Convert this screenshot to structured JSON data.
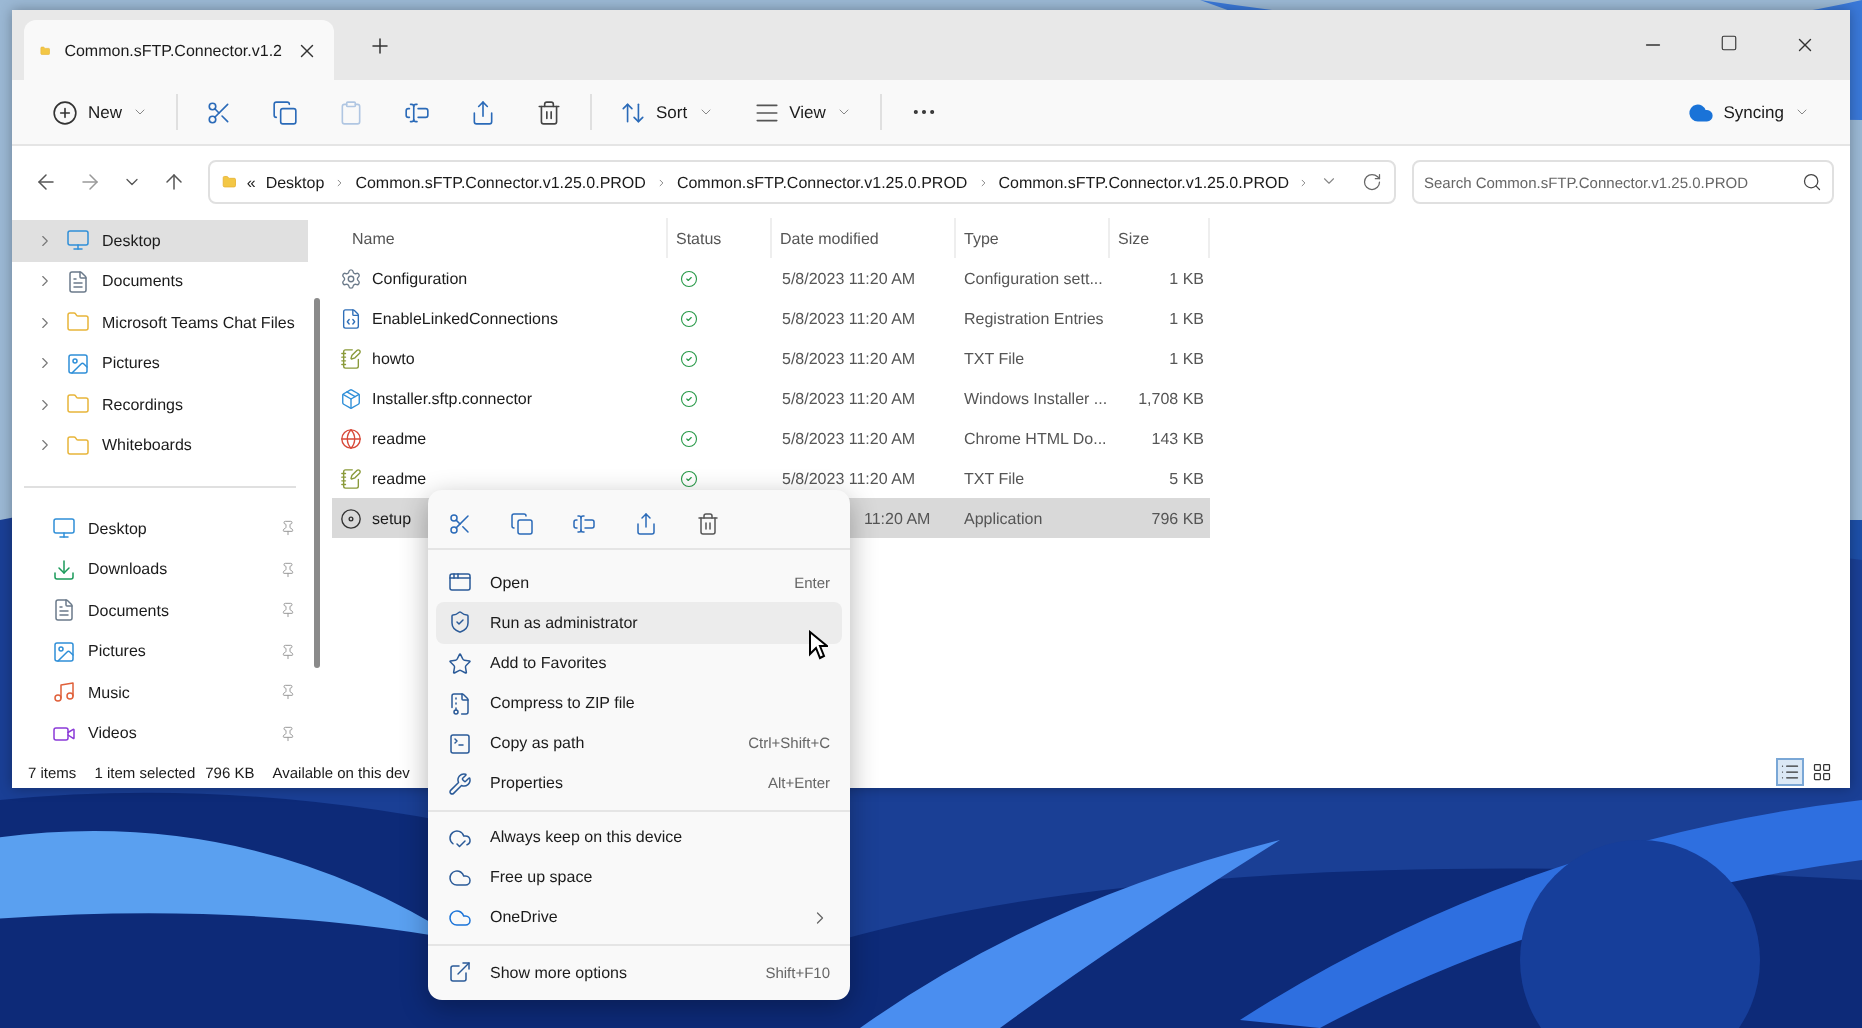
{
  "tab": {
    "title": "Common.sFTP.Connector.v1.2"
  },
  "toolbar": {
    "new": "New",
    "paste_disabled": true,
    "sort": "Sort",
    "view": "View",
    "sync": "Syncing"
  },
  "address": {
    "overflow": "«",
    "crumbs": [
      "Desktop",
      "Common.sFTP.Connector.v1.25.0.PROD",
      "Common.sFTP.Connector.v1.25.0.PROD",
      "Common.sFTP.Connector.v1.25.0.PROD"
    ]
  },
  "search": {
    "placeholder": "Search Common.sFTP.Connector.v1.25.0.PROD"
  },
  "sidebar": {
    "tree": [
      {
        "label": "Desktop",
        "selected": true
      },
      {
        "label": "Documents",
        "selected": false
      },
      {
        "label": "Microsoft Teams Chat Files",
        "selected": false
      },
      {
        "label": "Pictures",
        "selected": false
      },
      {
        "label": "Recordings",
        "selected": false
      },
      {
        "label": "Whiteboards",
        "selected": false
      }
    ],
    "quick_access": [
      {
        "label": "Desktop"
      },
      {
        "label": "Downloads"
      },
      {
        "label": "Documents"
      },
      {
        "label": "Pictures"
      },
      {
        "label": "Music"
      },
      {
        "label": "Videos"
      }
    ]
  },
  "table": {
    "columns": [
      "Name",
      "Status",
      "Date modified",
      "Type",
      "Size"
    ],
    "rows": [
      {
        "name": "Configuration",
        "synced": true,
        "date": "5/8/2023 11:20 AM",
        "type": "Configuration sett...",
        "size": "1 KB",
        "selected": false
      },
      {
        "name": "EnableLinkedConnections",
        "synced": true,
        "date": "5/8/2023 11:20 AM",
        "type": "Registration Entries",
        "size": "1 KB",
        "selected": false
      },
      {
        "name": "howto",
        "synced": true,
        "date": "5/8/2023 11:20 AM",
        "type": "TXT File",
        "size": "1 KB",
        "selected": false
      },
      {
        "name": "Installer.sftp.connector",
        "synced": true,
        "date": "5/8/2023 11:20 AM",
        "type": "Windows Installer ...",
        "size": "1,708 KB",
        "selected": false
      },
      {
        "name": "readme",
        "synced": true,
        "date": "5/8/2023 11:20 AM",
        "type": "Chrome HTML Do...",
        "size": "143 KB",
        "selected": false
      },
      {
        "name": "readme",
        "synced": true,
        "date": "5/8/2023 11:20 AM",
        "type": "TXT File",
        "size": "5 KB",
        "selected": false
      },
      {
        "name": "setup",
        "date": "11:20 AM",
        "type": "Application",
        "size": "796 KB",
        "selected": true
      }
    ]
  },
  "status_bar": {
    "count": "7 items",
    "selection": "1 item selected",
    "size": "796 KB",
    "availability": "Available on this dev",
    "views": [
      {
        "selected": true
      },
      {
        "selected": false
      }
    ]
  },
  "context_menu": {
    "groups": [
      [
        {
          "label": "Open",
          "shortcut": "Enter",
          "highlighted": false
        },
        {
          "label": "Run as administrator",
          "highlighted": true
        },
        {
          "label": "Add to Favorites",
          "highlighted": false
        },
        {
          "label": "Compress to ZIP file",
          "highlighted": false
        },
        {
          "label": "Copy as path",
          "shortcut": "Ctrl+Shift+C",
          "highlighted": false
        },
        {
          "label": "Properties",
          "shortcut": "Alt+Enter",
          "highlighted": false
        }
      ],
      [
        {
          "label": "Always keep on this device",
          "highlighted": false
        },
        {
          "label": "Free up space",
          "highlighted": false
        },
        {
          "label": "OneDrive",
          "submenu": true,
          "highlighted": false
        }
      ],
      [
        {
          "label": "Show more options",
          "shortcut": "Shift+F10",
          "highlighted": false
        }
      ]
    ]
  }
}
